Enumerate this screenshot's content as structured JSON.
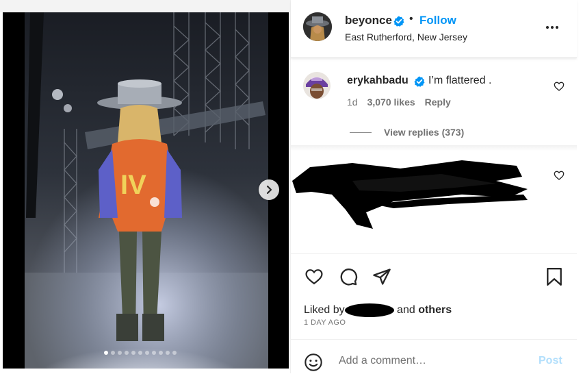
{
  "post": {
    "author": "beyonce",
    "follow_label": "Follow",
    "separator": "•",
    "location": "East Rutherford, New Jersey",
    "more_icon": "more-options-icon"
  },
  "media": {
    "slide_count": 11,
    "active_slide": 1,
    "next_icon": "chevron-right-icon"
  },
  "comments": [
    {
      "username": "erykahbadu",
      "text": "I’m flattered .",
      "age": "1d",
      "likes": "3,070 likes",
      "reply_label": "Reply",
      "view_replies": "View replies (373)"
    }
  ],
  "likes": {
    "prefix": "Liked by",
    "connector": "and",
    "others": "others",
    "time_ago": "1 DAY AGO"
  },
  "comment_box": {
    "placeholder": "Add a comment…",
    "post_label": "Post"
  },
  "colors": {
    "accent": "#0095f6",
    "post_disabled": "#b2dffc",
    "text": "#262626",
    "muted": "#737373"
  }
}
